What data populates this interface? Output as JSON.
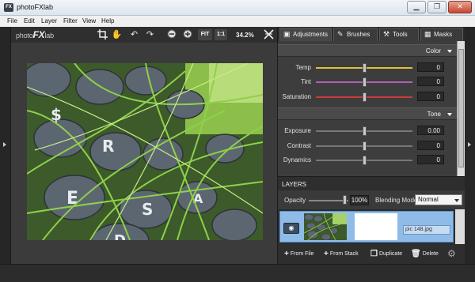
{
  "window": {
    "title": "photoFXlab",
    "controls": {
      "minimize": "▁",
      "maximize": "❐",
      "close": "✕"
    }
  },
  "menubar": [
    "File",
    "Edit",
    "Layer",
    "Filter",
    "View",
    "Help"
  ],
  "toolbar": {
    "logo_prefix": "photo",
    "logo_fx": "FX",
    "logo_suffix": "lab",
    "fit_label": "FIT",
    "one_to_one_label": "1:1",
    "zoom_level": "34.2%",
    "icons": [
      "crop-icon",
      "hand-icon",
      "undo-icon",
      "redo-icon",
      "zoom-out-icon",
      "zoom-in-icon",
      "fit-icon",
      "actual-size-icon",
      "reset-icon"
    ]
  },
  "panel": {
    "tabs": [
      {
        "label": "Adjustments",
        "icon": "adjustments-icon",
        "active": true
      },
      {
        "label": "Brushes",
        "icon": "brush-icon",
        "active": false
      },
      {
        "label": "Tools",
        "icon": "tools-icon",
        "active": false
      },
      {
        "label": "Masks",
        "icon": "masks-icon",
        "active": false
      }
    ],
    "sections": [
      {
        "title": "Color",
        "sliders": [
          {
            "label": "Temp",
            "value": "0",
            "position": 0.5,
            "color": "#d8c23c"
          },
          {
            "label": "Tint",
            "value": "0",
            "position": 0.5,
            "color": "#b55fb5"
          },
          {
            "label": "Saturation",
            "value": "0",
            "position": 0.5,
            "color": "#c93b3b"
          }
        ]
      },
      {
        "title": "Tone",
        "sliders": [
          {
            "label": "Exposure",
            "value": "0.00",
            "position": 0.5,
            "color": "#9a9a9a"
          },
          {
            "label": "Contrast",
            "value": "0",
            "position": 0.5,
            "color": "#9a9a9a"
          },
          {
            "label": "Dynamics",
            "value": "0",
            "position": 0.5,
            "color": "#9a9a9a"
          }
        ]
      }
    ]
  },
  "layers": {
    "header": "LAYERS",
    "opacity_label": "Opacity",
    "opacity_value": "100%",
    "blending_label": "Blending Mode",
    "blending_value": "Normal",
    "items": [
      {
        "name": "pic 148.jpg",
        "visible": true,
        "selected": true
      }
    ],
    "actions": [
      {
        "label": "From File",
        "icon": "plus-icon"
      },
      {
        "label": "From Stack",
        "icon": "plus-icon"
      },
      {
        "label": "Duplicate",
        "icon": "duplicate-icon"
      },
      {
        "label": "Delete",
        "icon": "trash-icon"
      }
    ]
  },
  "colors": {
    "accent_selected": "#8fbbe8",
    "panel_bg": "#353535",
    "canvas_bg": "#3b3b3b"
  }
}
